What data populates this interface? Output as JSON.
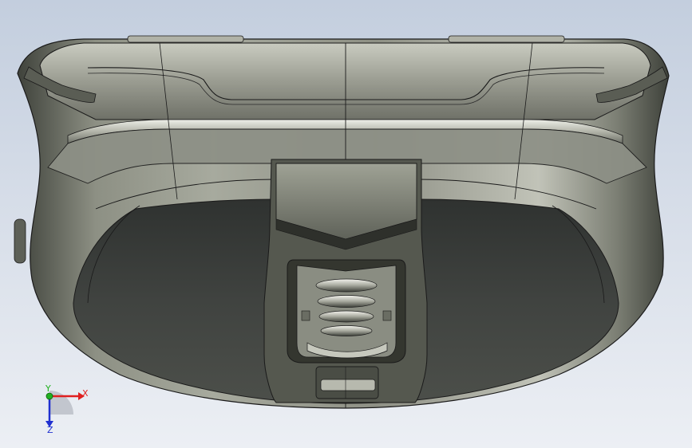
{
  "viewport": {
    "background_top": "#c3cede",
    "background_bottom": "#eceff4",
    "model_body_color": "#6b6d64",
    "model_dark_face_color": "#3e413a",
    "edge_color": "#1a1a1a"
  },
  "triad": {
    "x_label": "X",
    "y_label": "Y",
    "z_label": "Z",
    "x_color": "#e02020",
    "y_color": "#20b020",
    "z_color": "#2030d0"
  }
}
